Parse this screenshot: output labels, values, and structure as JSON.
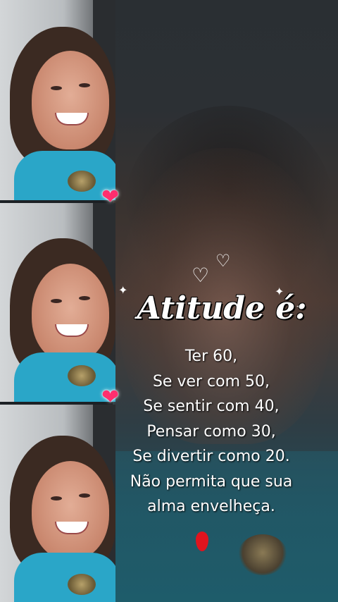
{
  "overlay": {
    "title": "Atitude é:",
    "lines": [
      "Ter 60,",
      "Se ver com 50,",
      "Se sentir com 40,",
      "Pensar como 30,",
      "Se divertir como 20.",
      "Não permita que sua",
      "alma envelheça."
    ]
  },
  "decor": {
    "heart_icons": [
      "heart-icon",
      "heart-icon"
    ],
    "outline_hearts": [
      "heart-outline-icon",
      "heart-outline-icon"
    ],
    "sparkles": [
      "sparkle-icon",
      "sparkle-icon",
      "sparkle-icon"
    ],
    "accent_colors": {
      "heart": "#ff2e6e",
      "drop": "#e0141e",
      "shirt": "#2aa6c8"
    }
  }
}
